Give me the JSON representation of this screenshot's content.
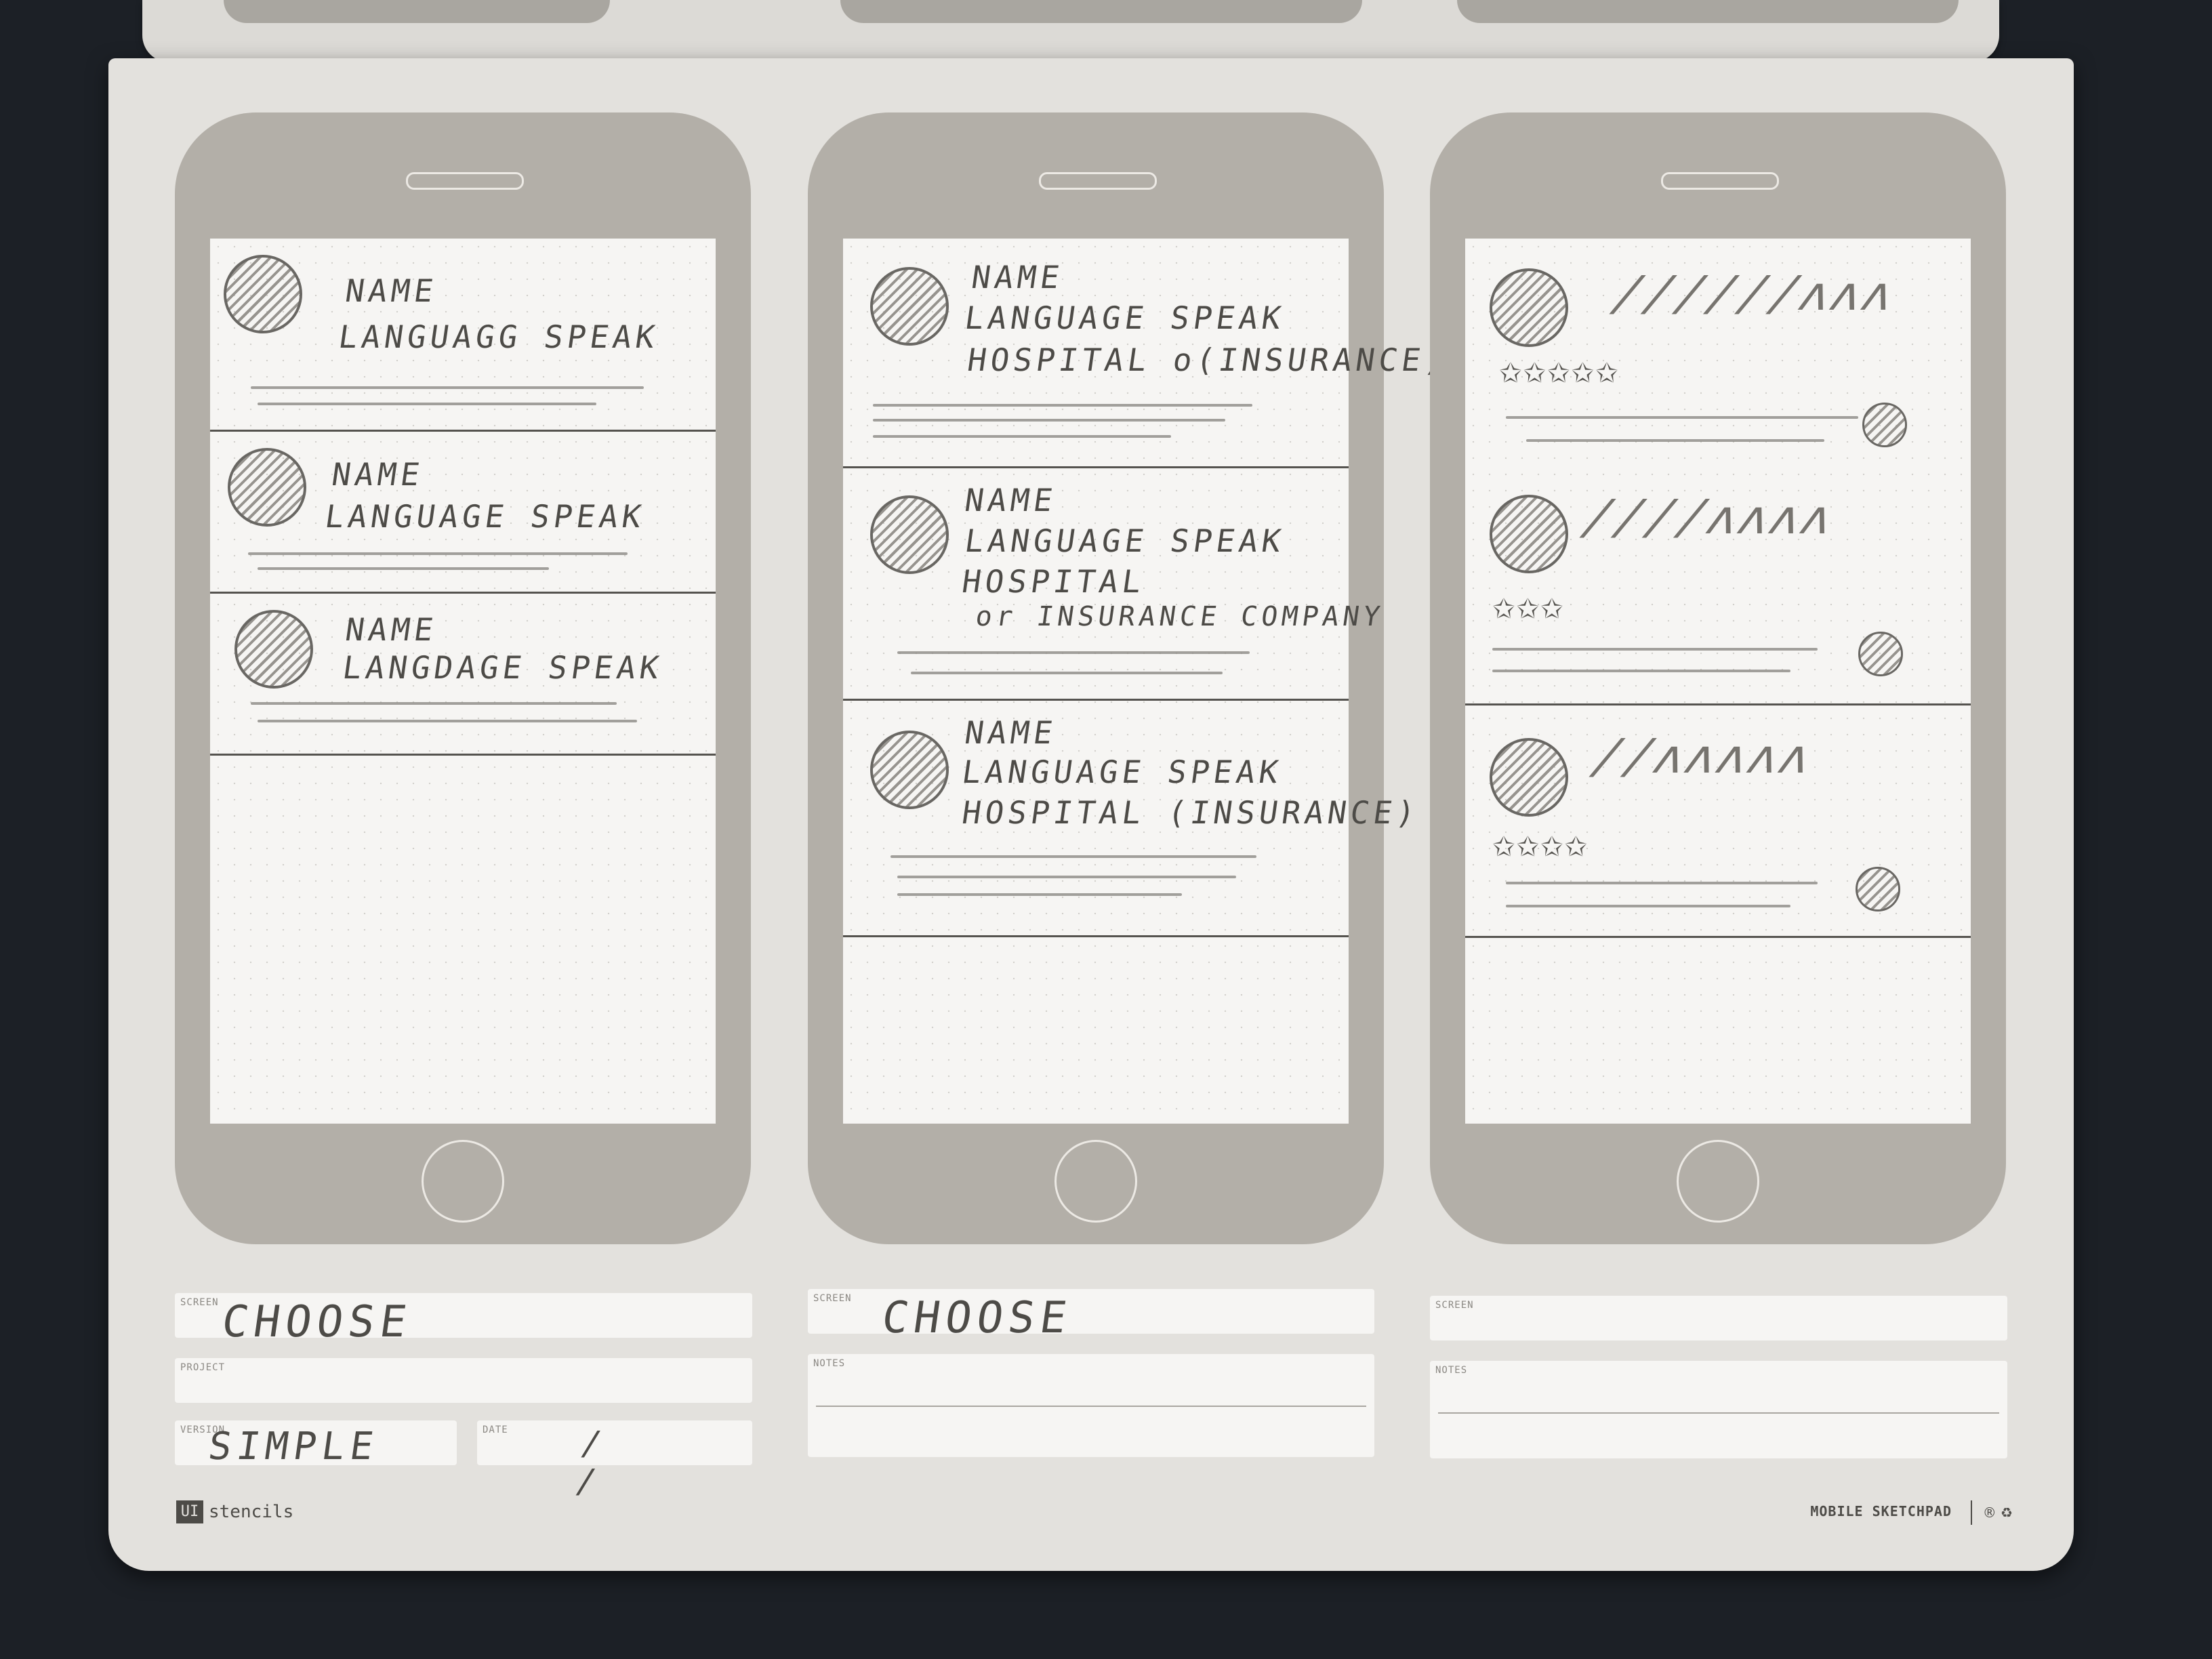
{
  "phones": [
    {
      "cards": [
        {
          "lines": [
            "NAME",
            "LANGUAGG SPEAK"
          ]
        },
        {
          "lines": [
            "NAME",
            "LANGUAGE SPEAK"
          ]
        },
        {
          "lines": [
            "NAME",
            "LANGDAGE SPEAK"
          ]
        }
      ],
      "screen_label": "SCREEN",
      "screen_value": "CHOOSE",
      "project_label": "PROJECT",
      "version_label": "VERSION",
      "version_value": "SIMPLE",
      "date_label": "DATE",
      "date_value": "/ /"
    },
    {
      "cards": [
        {
          "lines": [
            "NAME",
            "LANGUAGE SPEAK",
            "HOSPITAL o(INSURANCE)"
          ]
        },
        {
          "lines": [
            "NAME",
            "LANGUAGE SPEAK",
            "HOSPITAL",
            "or INSURANCE COMPANY"
          ]
        },
        {
          "lines": [
            "NAME",
            "LANGUAGE SPEAK",
            "HOSPITAL (INSURANCE)"
          ]
        }
      ],
      "screen_label": "SCREEN",
      "screen_value": "CHOOSE",
      "notes_label": "NOTES"
    },
    {
      "cards": [
        {
          "stars": "✩✩✩✩✩"
        },
        {
          "stars": "✩✩✩"
        },
        {
          "stars": "✩✩✩✩"
        }
      ],
      "screen_label": "SCREEN",
      "notes_label": "NOTES"
    }
  ],
  "brand": {
    "logo": "UI",
    "name": "stencils"
  },
  "product": {
    "name": "MOBILE SKETCHPAD",
    "icons": "® ♻"
  }
}
